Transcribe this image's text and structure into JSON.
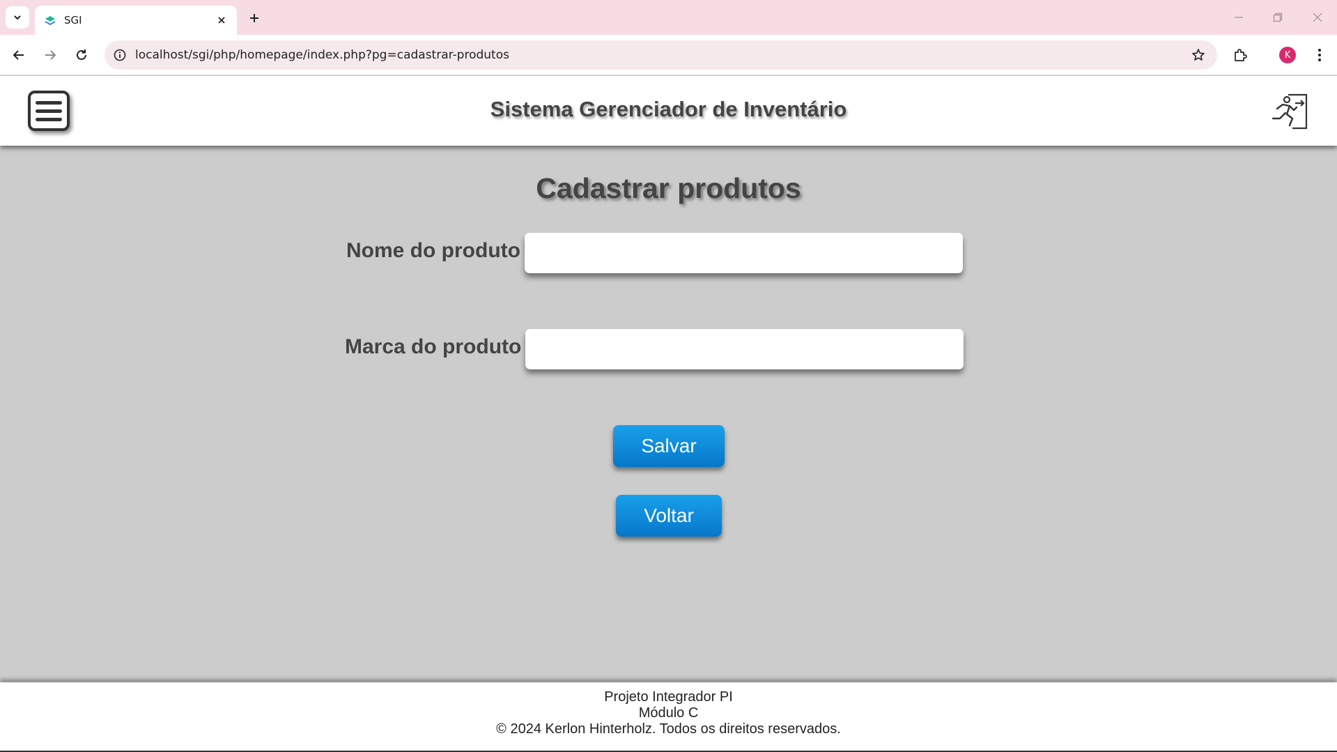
{
  "browser": {
    "tab_title": "SGI",
    "url": "localhost/sgi/php/homepage/index.php?pg=cadastrar-produtos",
    "profile_initial": "K"
  },
  "header": {
    "title": "Sistema Gerenciador de Inventário"
  },
  "form": {
    "title": "Cadastrar produtos",
    "name_label": "Nome do produto",
    "name_value": "",
    "brand_label": "Marca do produto",
    "brand_value": "",
    "save_label": "Salvar",
    "back_label": "Voltar"
  },
  "footer": {
    "line1": "Projeto Integrador PI",
    "line2": "Módulo C",
    "line3": "© 2024 Kerlon Hinterholz. Todos os direitos reservados."
  },
  "colors": {
    "button_blue": "#0a86d6",
    "page_background": "#cccccc",
    "tabstrip": "#f7dde3"
  }
}
